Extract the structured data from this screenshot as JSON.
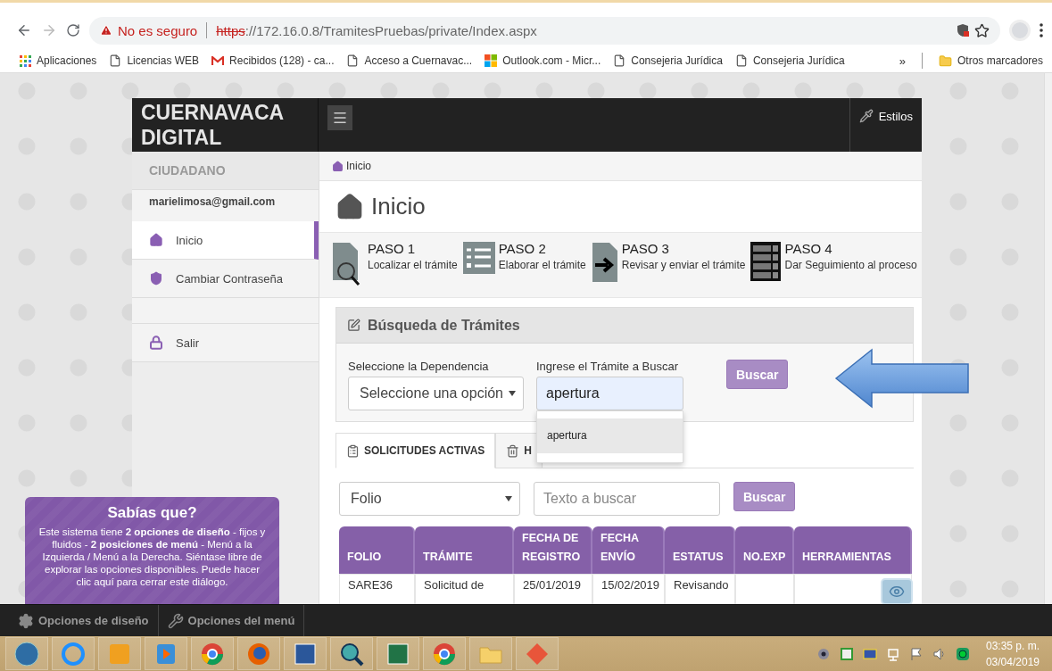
{
  "browser": {
    "security": "No es seguro",
    "url_scheme": "https",
    "url_rest": "://172.16.0.8/TramitesPruebas/private/Index.aspx"
  },
  "bookmarks": [
    {
      "label": "Aplicaciones",
      "kind": "apps"
    },
    {
      "label": "Licencias WEB",
      "kind": "page"
    },
    {
      "label": "Recibidos (128) - ca...",
      "kind": "mail"
    },
    {
      "label": "Acceso a Cuernavac...",
      "kind": "page"
    },
    {
      "label": "Outlook.com - Micr...",
      "kind": "tiles"
    },
    {
      "label": "Consejeria Jurídica",
      "kind": "page"
    },
    {
      "label": "Consejeria Jurídica",
      "kind": "page"
    }
  ],
  "bookmarks_more": "»",
  "other_bookmarks": "Otros marcadores",
  "brand": {
    "line1": "CUERNAVACA",
    "line2": "DIGITAL"
  },
  "header": {
    "styles_button": "Estilos"
  },
  "sidebar": {
    "role": "CIUDADANO",
    "email": "marielimosa@gmail.com",
    "items": [
      {
        "label": "Inicio",
        "kind": "home",
        "selected": true
      },
      {
        "label": "Cambiar Contraseña",
        "kind": "shield",
        "selected": false
      },
      {
        "label": "Salir",
        "kind": "lock",
        "selected": false
      }
    ]
  },
  "breadcrumb": "Inicio",
  "page_title": "Inicio",
  "steps": [
    {
      "title": "PASO 1",
      "text": "Localizar el trámite",
      "kind": "search-doc"
    },
    {
      "title": "PASO 2",
      "text": "Elaborar el trámite",
      "kind": "list"
    },
    {
      "title": "PASO 3",
      "text": "Revisar y enviar el trámite",
      "kind": "arrow-doc"
    },
    {
      "title": "PASO 4",
      "text": "Dar Seguimiento al proceso",
      "kind": "checklist"
    }
  ],
  "search_panel": {
    "title": "Búsqueda de Trámites",
    "dependency_label": "Seleccione la Dependencia",
    "dependency_value": "Seleccione una opción",
    "query_label": "Ingrese el Trámite a Buscar",
    "query_value": "apertura",
    "button": "Buscar",
    "suggestions": [
      {
        "label": "apertura",
        "selected": true
      }
    ]
  },
  "tabs": [
    {
      "label": "SOLICITUDES ACTIVAS",
      "kind": "clipboard",
      "selected": true
    },
    {
      "label": "H",
      "kind": "trash",
      "selected": false
    }
  ],
  "filter": {
    "field": "Folio",
    "placeholder": "Texto a buscar",
    "button": "Buscar"
  },
  "table": {
    "columns": [
      "FOLIO",
      "TRÁMITE",
      "FECHA DE REGISTRO",
      "FECHA ENVÍO",
      "ESTATUS",
      "NO.EXP",
      "HERRAMIENTAS"
    ],
    "rows": [
      {
        "folio": "SARE36",
        "tramite": "Solicitud de",
        "registro": "25/01/2019",
        "envio": "15/02/2019",
        "estatus": "Revisando"
      }
    ]
  },
  "tip": {
    "title": "Sabías que?",
    "text": "Este sistema tiene **2 opciones de diseño** - fijos y fluidos - **2 posiciones de menú** - Menú a la Izquierda / Menú a la Derecha. Siéntase libre de explorar las opciones disponibles. Puede hacer clic aquí para cerrar este diálogo."
  },
  "footer_bar": [
    {
      "label": "Opciones de diseño",
      "kind": "gear"
    },
    {
      "label": "Opciones del menú",
      "kind": "tools"
    }
  ],
  "taskbar": {
    "apps": [
      {
        "kind": "start"
      },
      {
        "kind": "ie"
      },
      {
        "kind": "outlook"
      },
      {
        "kind": "media"
      },
      {
        "kind": "chrome"
      },
      {
        "kind": "firefox"
      },
      {
        "kind": "word"
      },
      {
        "kind": "magnifier"
      },
      {
        "kind": "excel"
      },
      {
        "kind": "chrome"
      },
      {
        "kind": "folder"
      },
      {
        "kind": "app"
      }
    ],
    "tray": [
      {
        "kind": "camera"
      },
      {
        "kind": "vnc"
      },
      {
        "kind": "monitor"
      },
      {
        "kind": "network"
      },
      {
        "kind": "flag"
      },
      {
        "kind": "volume"
      },
      {
        "kind": "green"
      }
    ],
    "time": "03:35 p. m.",
    "date": "03/04/2019"
  }
}
